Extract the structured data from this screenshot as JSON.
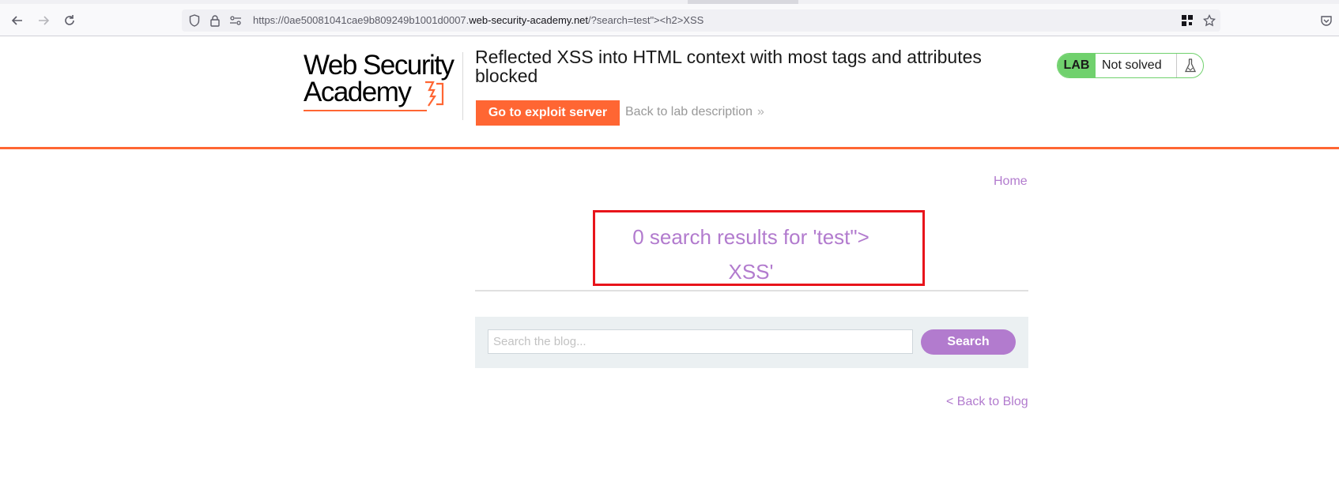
{
  "browser": {
    "url_prefix": "https://0ae50081041cae9b809249b1001d0007.",
    "url_domain": "web-security-academy.net",
    "url_suffix": "/?search=test\"><h2>XSS",
    "icons": [
      "back-icon",
      "forward-icon",
      "reload-icon",
      "shield-icon",
      "lock-icon",
      "permissions-icon",
      "extensions-icon",
      "bookmark-star-icon",
      "pocket-icon"
    ]
  },
  "header": {
    "logo_line1": "Web Security",
    "logo_line2": "Academy",
    "lab_title": "Reflected XSS into HTML context with most tags and attributes blocked",
    "exploit_button": "Go to exploit server",
    "back_link": "Back to lab description",
    "back_link_chevron": "»",
    "status_badge": "LAB",
    "status_text": "Not solved",
    "accent_color": "#ff6633",
    "status_color": "#70d16d"
  },
  "nav": {
    "home": "Home"
  },
  "results": {
    "line1": "0 search results for 'test\">",
    "line2": "XSS'",
    "text_color": "#b27bce",
    "highlight_color": "#e8141b"
  },
  "search": {
    "placeholder": "Search the blog...",
    "value": "",
    "button": "Search"
  },
  "footer": {
    "back_to_blog": "< Back to Blog"
  }
}
